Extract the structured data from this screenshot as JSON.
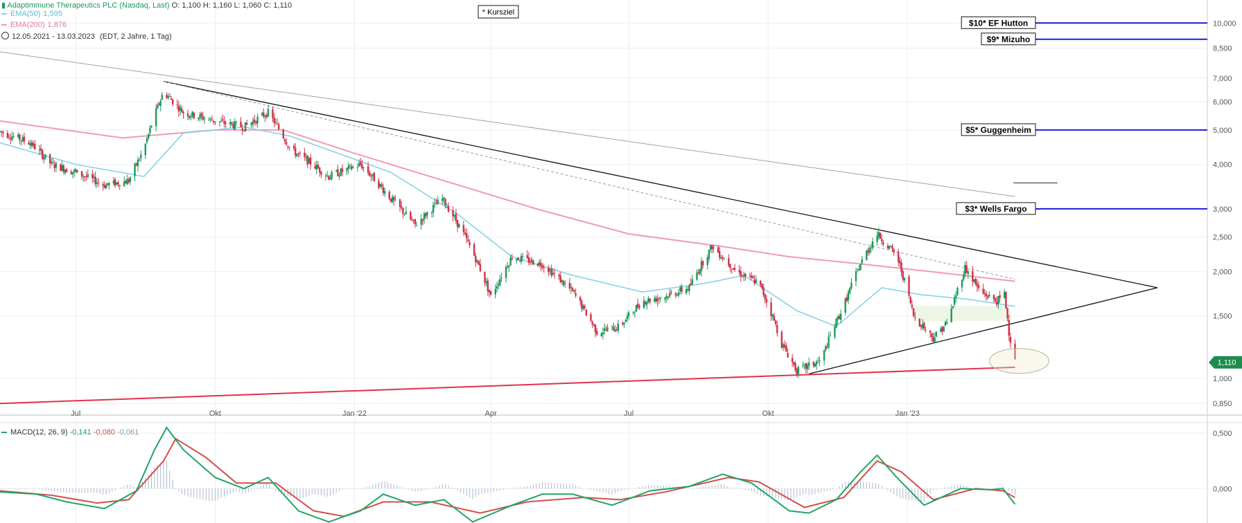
{
  "header": {
    "title": "Adaptimmune Therapeutics PLC (Nasdaq, Last)",
    "open_label": "O:",
    "open_value": "1,100",
    "high_label": "H:",
    "high_value": "1,160",
    "low_label": "L:",
    "low_value": "1,060",
    "close_label": "C:",
    "close_value": "1,110",
    "ema50_label": "EMA(50)",
    "ema50_value": "1,595",
    "ema200_label": "EMA(200)",
    "ema200_value": "1,876",
    "date_range": "12.05.2021 - 13.03.2023",
    "interval": "(EDT, 2 Jahre, 1 Tag)"
  },
  "macd_legend": {
    "label": "MACD(12, 26, 9)",
    "macd": "-0,141",
    "signal": "-0,080",
    "hist": "-0,061"
  },
  "price_tag": "1,110",
  "kursziel_note": "* Kursziel",
  "colors": {
    "ema50": "#7fd0e6",
    "ema200": "#ef9bb6",
    "up": "#1a9a5a",
    "down": "#d03048",
    "macd": "#21a366",
    "signal": "#d0504a",
    "hist": "#a9b6cc",
    "targets": "#1a1adb",
    "support": "#e0304a",
    "trend": "#111111"
  },
  "chart_data": [
    {
      "type": "candlestick",
      "title": "Adaptimmune Therapeutics PLC (Nasdaq, Last)",
      "scale": "log",
      "x_ticks": [
        "Jul",
        "Okt",
        "Jan '22",
        "Apr",
        "Jul",
        "Okt",
        "Jan '23"
      ],
      "y_ticks": [
        "0,850",
        "1,000",
        "1,500",
        "2,000",
        "2,500",
        "3,000",
        "4,000",
        "5,000",
        "6,000",
        "7,000",
        "8,500",
        "10,000"
      ],
      "ylim": [
        0.81,
        11.2
      ],
      "close_path": [
        [
          "2021-05-12",
          4.95
        ],
        [
          "2021-06-01",
          4.6
        ],
        [
          "2021-06-15",
          4.0
        ],
        [
          "2021-07-01",
          3.8
        ],
        [
          "2021-07-20",
          3.5
        ],
        [
          "2021-08-05",
          3.6
        ],
        [
          "2021-08-15",
          4.4
        ],
        [
          "2021-08-28",
          6.4
        ],
        [
          "2021-09-10",
          5.6
        ],
        [
          "2021-10-01",
          5.3
        ],
        [
          "2021-10-20",
          5.1
        ],
        [
          "2021-11-05",
          5.6
        ],
        [
          "2021-11-20",
          4.4
        ],
        [
          "2021-12-15",
          3.7
        ],
        [
          "2022-01-05",
          4.0
        ],
        [
          "2022-01-25",
          3.2
        ],
        [
          "2022-02-10",
          2.7
        ],
        [
          "2022-02-28",
          3.2
        ],
        [
          "2022-03-15",
          2.5
        ],
        [
          "2022-04-01",
          1.7
        ],
        [
          "2022-04-15",
          2.2
        ],
        [
          "2022-05-05",
          2.1
        ],
        [
          "2022-05-25",
          1.75
        ],
        [
          "2022-06-10",
          1.35
        ],
        [
          "2022-06-25",
          1.4
        ],
        [
          "2022-07-10",
          1.65
        ],
        [
          "2022-07-25",
          1.7
        ],
        [
          "2022-08-10",
          1.8
        ],
        [
          "2022-08-25",
          2.35
        ],
        [
          "2022-09-10",
          2.0
        ],
        [
          "2022-09-25",
          1.85
        ],
        [
          "2022-10-10",
          1.25
        ],
        [
          "2022-10-20",
          1.05
        ],
        [
          "2022-11-05",
          1.12
        ],
        [
          "2022-11-20",
          1.6
        ],
        [
          "2022-12-01",
          2.1
        ],
        [
          "2022-12-12",
          2.55
        ],
        [
          "2022-12-25",
          2.2
        ],
        [
          "2023-01-05",
          1.5
        ],
        [
          "2023-01-18",
          1.3
        ],
        [
          "2023-01-28",
          1.45
        ],
        [
          "2023-02-08",
          2.05
        ],
        [
          "2023-02-18",
          1.75
        ],
        [
          "2023-03-01",
          1.65
        ],
        [
          "2023-03-06",
          1.72
        ],
        [
          "2023-03-09",
          1.35
        ],
        [
          "2023-03-13",
          1.11
        ]
      ],
      "ema50_path": [
        [
          "2021-05-12",
          4.6
        ],
        [
          "2021-07-01",
          4.0
        ],
        [
          "2021-08-15",
          3.7
        ],
        [
          "2021-09-10",
          4.9
        ],
        [
          "2021-10-20",
          5.1
        ],
        [
          "2021-11-20",
          4.8
        ],
        [
          "2022-01-25",
          3.8
        ],
        [
          "2022-03-10",
          2.9
        ],
        [
          "2022-04-15",
          2.2
        ],
        [
          "2022-05-25",
          1.95
        ],
        [
          "2022-07-10",
          1.75
        ],
        [
          "2022-08-20",
          1.85
        ],
        [
          "2022-09-15",
          1.95
        ],
        [
          "2022-10-20",
          1.55
        ],
        [
          "2022-11-15",
          1.4
        ],
        [
          "2022-12-15",
          1.8
        ],
        [
          "2023-01-10",
          1.72
        ],
        [
          "2023-02-10",
          1.67
        ],
        [
          "2023-03-13",
          1.595
        ]
      ],
      "ema200_path": [
        [
          "2021-05-12",
          5.3
        ],
        [
          "2021-08-01",
          4.75
        ],
        [
          "2021-10-01",
          5.0
        ],
        [
          "2021-11-15",
          5.0
        ],
        [
          "2022-01-01",
          4.3
        ],
        [
          "2022-03-01",
          3.6
        ],
        [
          "2022-05-01",
          3.0
        ],
        [
          "2022-07-01",
          2.55
        ],
        [
          "2022-09-01",
          2.35
        ],
        [
          "2022-10-15",
          2.2
        ],
        [
          "2022-12-01",
          2.1
        ],
        [
          "2023-01-15",
          2.0
        ],
        [
          "2023-03-13",
          1.876
        ]
      ],
      "drawn_lines": [
        {
          "name": "upper-trendline",
          "from": [
            "2021-08-28",
            6.85
          ],
          "to": [
            "2023-06-15",
            1.8
          ]
        },
        {
          "name": "lower-trendline",
          "from": [
            "2022-10-28",
            1.03
          ],
          "to": [
            "2023-06-15",
            1.8
          ]
        },
        {
          "name": "dashed-trendline",
          "from": [
            "2021-08-28",
            6.85
          ],
          "to": [
            "2023-03-13",
            1.9
          ]
        },
        {
          "name": "long-grey-trendline",
          "from": [
            "2021-05-12",
            8.3
          ],
          "to": [
            "2023-03-13",
            3.25
          ]
        },
        {
          "name": "red-support-line",
          "from": [
            "2021-05-12",
            0.85
          ],
          "to": [
            "2023-03-13",
            1.075
          ]
        },
        {
          "name": "short-black-line",
          "from": [
            "2023-03-12",
            3.55
          ],
          "to": [
            "2023-04-10",
            3.55
          ]
        }
      ],
      "price_targets": [
        {
          "label": "$10* EF Hutton",
          "value": 10.0
        },
        {
          "label": "$9* Mizuho",
          "value": 9.0
        },
        {
          "label": "$5* Guggenheim",
          "value": 5.0
        },
        {
          "label": "$3* Wells Fargo",
          "value": 3.0
        }
      ],
      "last_price": 1.11
    },
    {
      "type": "line",
      "title": "MACD(12, 26, 9)",
      "y_ticks": [
        "0,500",
        "0,000"
      ],
      "ylim": [
        -0.31,
        0.6
      ],
      "macd_path": [
        [
          "2021-05-12",
          -0.03
        ],
        [
          "2021-06-05",
          -0.05
        ],
        [
          "2021-06-25",
          -0.12
        ],
        [
          "2021-07-20",
          -0.18
        ],
        [
          "2021-08-10",
          -0.02
        ],
        [
          "2021-08-22",
          0.35
        ],
        [
          "2021-08-30",
          0.55
        ],
        [
          "2021-09-10",
          0.35
        ],
        [
          "2021-10-01",
          0.1
        ],
        [
          "2021-10-20",
          0.0
        ],
        [
          "2021-11-05",
          0.1
        ],
        [
          "2021-11-25",
          -0.2
        ],
        [
          "2021-12-15",
          -0.3
        ],
        [
          "2022-01-05",
          -0.2
        ],
        [
          "2022-01-20",
          -0.05
        ],
        [
          "2022-02-10",
          -0.15
        ],
        [
          "2022-03-01",
          -0.1
        ],
        [
          "2022-03-20",
          -0.3
        ],
        [
          "2022-04-15",
          -0.15
        ],
        [
          "2022-05-05",
          -0.05
        ],
        [
          "2022-05-25",
          -0.05
        ],
        [
          "2022-06-20",
          -0.15
        ],
        [
          "2022-07-15",
          -0.02
        ],
        [
          "2022-08-10",
          0.02
        ],
        [
          "2022-09-01",
          0.13
        ],
        [
          "2022-09-20",
          0.05
        ],
        [
          "2022-10-15",
          -0.2
        ],
        [
          "2022-10-28",
          -0.22
        ],
        [
          "2022-11-15",
          -0.1
        ],
        [
          "2022-12-01",
          0.15
        ],
        [
          "2022-12-12",
          0.3
        ],
        [
          "2022-12-25",
          0.1
        ],
        [
          "2023-01-12",
          -0.15
        ],
        [
          "2023-02-05",
          0.0
        ],
        [
          "2023-02-25",
          -0.01
        ],
        [
          "2023-03-05",
          0.0
        ],
        [
          "2023-03-13",
          -0.141
        ]
      ],
      "signal_path": [
        [
          "2021-05-12",
          -0.02
        ],
        [
          "2021-06-15",
          -0.06
        ],
        [
          "2021-07-15",
          -0.13
        ],
        [
          "2021-08-05",
          -0.1
        ],
        [
          "2021-08-28",
          0.25
        ],
        [
          "2021-09-05",
          0.45
        ],
        [
          "2021-09-25",
          0.28
        ],
        [
          "2021-10-15",
          0.05
        ],
        [
          "2021-11-10",
          0.05
        ],
        [
          "2021-12-05",
          -0.2
        ],
        [
          "2021-12-25",
          -0.25
        ],
        [
          "2022-01-20",
          -0.12
        ],
        [
          "2022-02-20",
          -0.12
        ],
        [
          "2022-03-25",
          -0.22
        ],
        [
          "2022-04-25",
          -0.12
        ],
        [
          "2022-06-01",
          -0.08
        ],
        [
          "2022-06-25",
          -0.1
        ],
        [
          "2022-07-25",
          -0.03
        ],
        [
          "2022-09-05",
          0.1
        ],
        [
          "2022-09-25",
          0.06
        ],
        [
          "2022-10-25",
          -0.17
        ],
        [
          "2022-11-20",
          -0.08
        ],
        [
          "2022-12-12",
          0.25
        ],
        [
          "2022-12-28",
          0.15
        ],
        [
          "2023-01-18",
          -0.1
        ],
        [
          "2023-02-15",
          0.0
        ],
        [
          "2023-03-05",
          -0.02
        ],
        [
          "2023-03-13",
          -0.08
        ]
      ]
    }
  ]
}
